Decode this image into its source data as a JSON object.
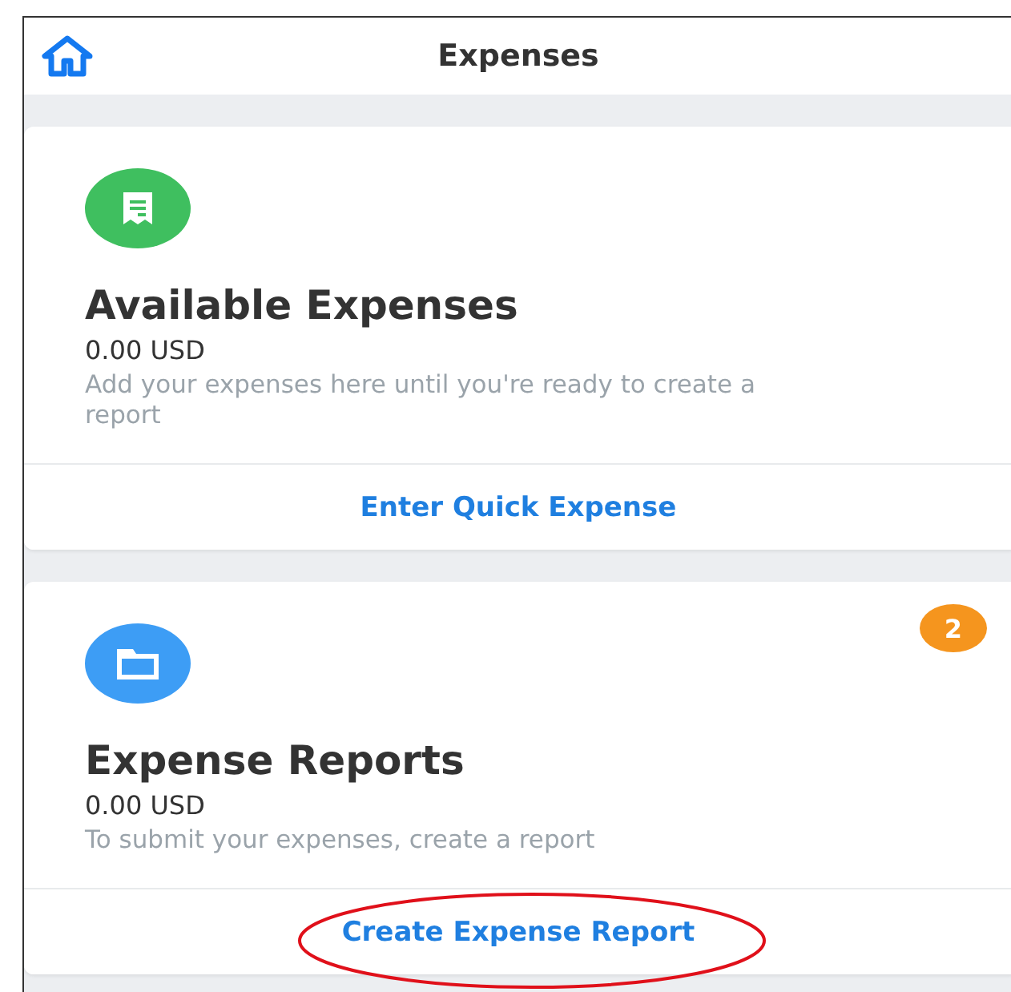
{
  "header": {
    "title": "Expenses"
  },
  "cards": [
    {
      "kind": "receipt",
      "color": "#3fbf5f",
      "title": "Available Expenses",
      "amount": "0.00 USD",
      "description": "Add your expenses here until you're ready to create a report",
      "action": "Enter Quick Expense",
      "highlighted": false
    },
    {
      "kind": "folder",
      "color": "#3d9df5",
      "title": "Expense Reports",
      "amount": "0.00 USD",
      "description": "To submit your expenses, create a report",
      "action": "Create Expense Report",
      "highlighted": true,
      "badge": "2"
    }
  ]
}
